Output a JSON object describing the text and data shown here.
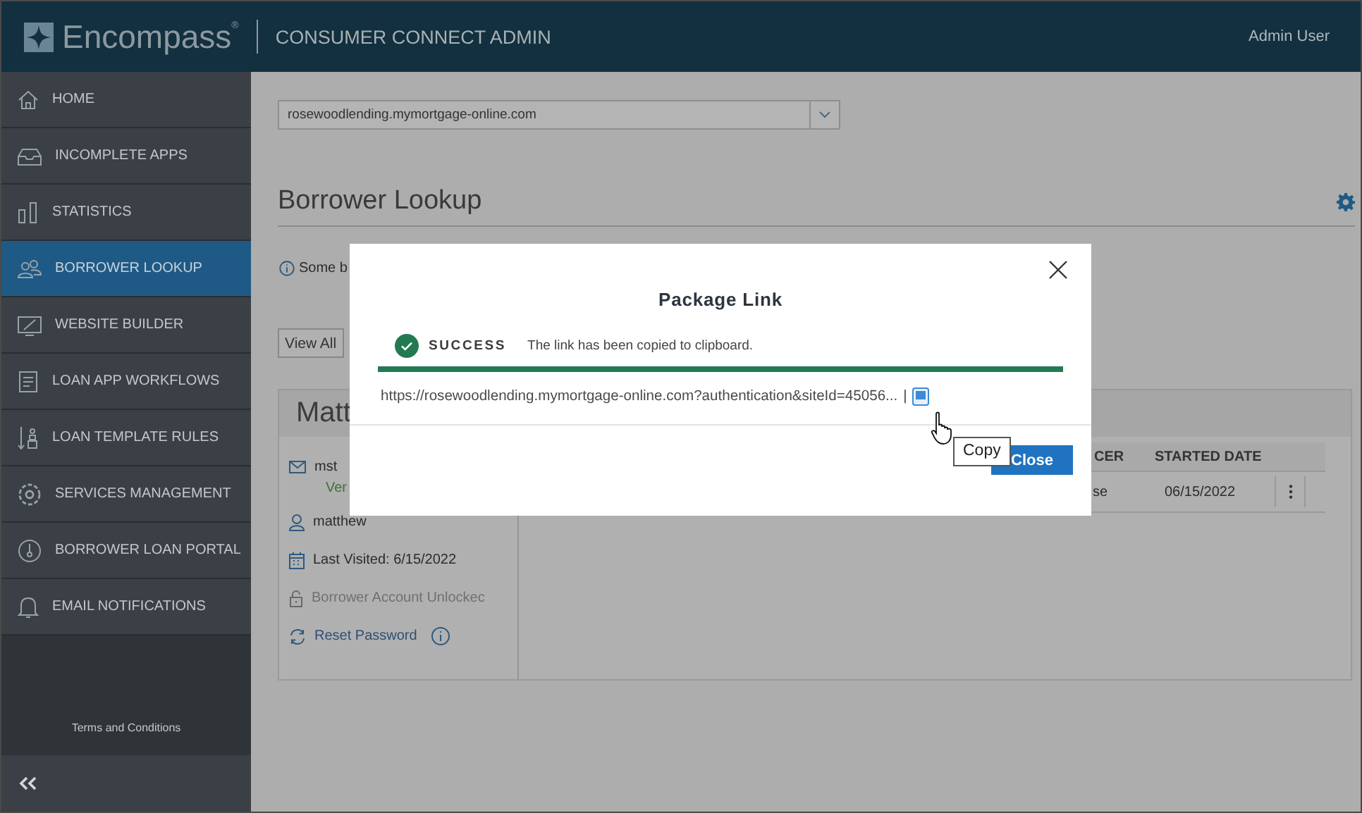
{
  "header": {
    "brand": "Encompass$^{®}$",
    "app_title": "CONSUMER CONNECT ADMIN",
    "user": "Admin User"
  },
  "sidebar": {
    "items": [
      {
        "label": "HOME",
        "selected": false
      },
      {
        "label": "INCOMPLETE APPS",
        "selected": false
      },
      {
        "label": "STATISTICS",
        "selected": false
      },
      {
        "label": "BORROWER LOOKUP",
        "selected": true
      },
      {
        "label": "WEBSITE BUILDER",
        "selected": false
      },
      {
        "label": "LOAN APP WORKFLOWS",
        "selected": false
      },
      {
        "label": "LOAN TEMPLATE RULES",
        "selected": false
      },
      {
        "label": "SERVICES MANAGEMENT",
        "selected": false
      },
      {
        "label": "BORROWER LOAN PORTAL",
        "selected": false
      },
      {
        "label": "EMAIL NOTIFICATIONS",
        "selected": false
      }
    ],
    "footer_link": "Terms and Conditions"
  },
  "site_select": {
    "value": "rosewoodlending.mymortgage-online.com"
  },
  "page_title": "Borrower Lookup",
  "notice": "Some b",
  "view_all": "View All",
  "borrower_card": {
    "name": "Matt",
    "email": "mst",
    "verified": "Ver",
    "username": "matthew",
    "last_visited": "Last Visited: 6/15/2022",
    "account_status": "Borrower Account Unlockec",
    "reset_password": "Reset Password",
    "table": {
      "columns": [
        "CER",
        "STARTED DATE"
      ],
      "rows": [
        {
          "cells": [
            "se",
            "06/15/2022"
          ]
        }
      ]
    }
  },
  "modal": {
    "title": "Package Link",
    "status": "SUCCESS",
    "message": "The link has been copied to clipboard.",
    "link": "https://rosewoodlending.mymortgage-online.com?authentication&siteId=45056...",
    "separator": "|",
    "tooltip": "Copy",
    "close_button": "Close"
  }
}
